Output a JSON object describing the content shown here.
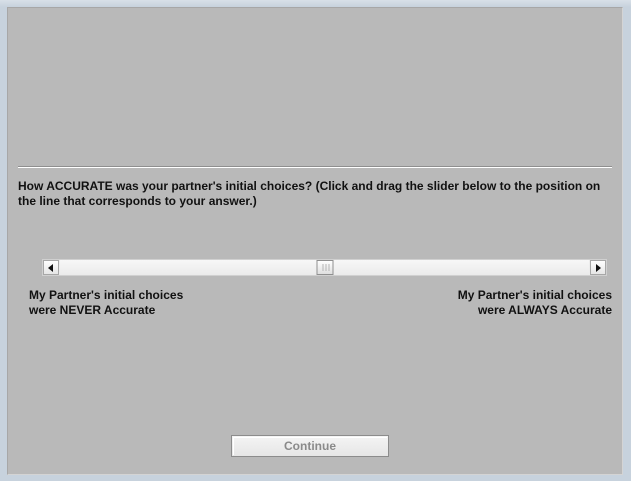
{
  "question": {
    "text": "How ACCURATE was your partner's initial choices? (Click and drag the slider below to the position on the line that corresponds to your answer.)"
  },
  "slider": {
    "value": 0.5,
    "left_label": {
      "line1": "My Partner's initial choices",
      "line2": "were NEVER Accurate"
    },
    "right_label": {
      "line1": "My Partner's initial choices",
      "line2": "were ALWAYS Accurate"
    },
    "left_icon": "left-arrow-icon",
    "right_icon": "right-arrow-icon"
  },
  "continue_button": {
    "label": "Continue",
    "state": "disabled"
  },
  "colors": {
    "window_background": "#c7d2dd",
    "panel_background": "#b9b9b9",
    "text": "#111111",
    "disabled_text": "#8a8a8a"
  }
}
